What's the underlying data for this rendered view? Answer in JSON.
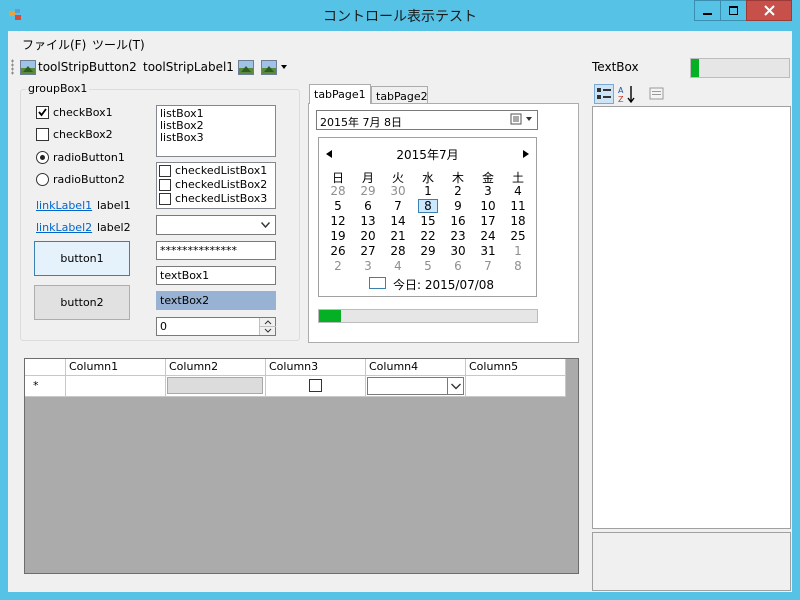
{
  "window": {
    "title": "コントロール表示テスト"
  },
  "menu": {
    "items": [
      "ファイル(F)",
      "ツール(T)"
    ]
  },
  "toolstrip": {
    "button_label": "toolStripButton2",
    "label": "toolStripLabel1"
  },
  "property_panel": {
    "title": "TextBox",
    "progress": 0.08
  },
  "groupbox": {
    "title": "groupBox1",
    "checkbox1": {
      "label": "checkBox1",
      "checked": true
    },
    "checkbox2": {
      "label": "checkBox2",
      "checked": false
    },
    "radio1": {
      "label": "radioButton1",
      "selected": true
    },
    "radio2": {
      "label": "radioButton2",
      "selected": false
    },
    "linklabel1": "linkLabel1",
    "label1": "label1",
    "linklabel2": "linkLabel2",
    "label2": "label2",
    "button1": "button1",
    "button2": "button2",
    "listbox_items": [
      "listBox1",
      "listBox2",
      "listBox3"
    ],
    "checked_list_items": [
      "checkedListBox1",
      "checkedListBox2",
      "checkedListBox3"
    ],
    "password": "**************",
    "textbox1": "textBox1",
    "textbox2": "textBox2",
    "numeric": "0"
  },
  "tabs": {
    "tab1": "tabPage1",
    "tab2": "tabPage2"
  },
  "datepicker": {
    "value": "2015年  7月  8日"
  },
  "calendar": {
    "month_title": "2015年7月",
    "weekdays": [
      "日",
      "月",
      "火",
      "水",
      "木",
      "金",
      "土"
    ],
    "weeks": [
      [
        "28",
        "29",
        "30",
        "1",
        "2",
        "3",
        "4"
      ],
      [
        "5",
        "6",
        "7",
        "8",
        "9",
        "10",
        "11"
      ],
      [
        "12",
        "13",
        "14",
        "15",
        "16",
        "17",
        "18"
      ],
      [
        "19",
        "20",
        "21",
        "22",
        "23",
        "24",
        "25"
      ],
      [
        "26",
        "27",
        "28",
        "29",
        "30",
        "31",
        "1"
      ],
      [
        "2",
        "3",
        "4",
        "5",
        "6",
        "7",
        "8"
      ]
    ],
    "selected_day": "8",
    "today_label": "今日: 2015/07/08"
  },
  "tab_progress": {
    "value": 0.1
  },
  "datagrid": {
    "columns": [
      "Column1",
      "Column2",
      "Column3",
      "Column4",
      "Column5"
    ],
    "new_row_marker": "*"
  },
  "colors": {
    "title_bar": "#56c2e6",
    "close_button": "#c7504a",
    "progress_fill": "#06b025",
    "selected_text_bg": "#98b2d3"
  }
}
